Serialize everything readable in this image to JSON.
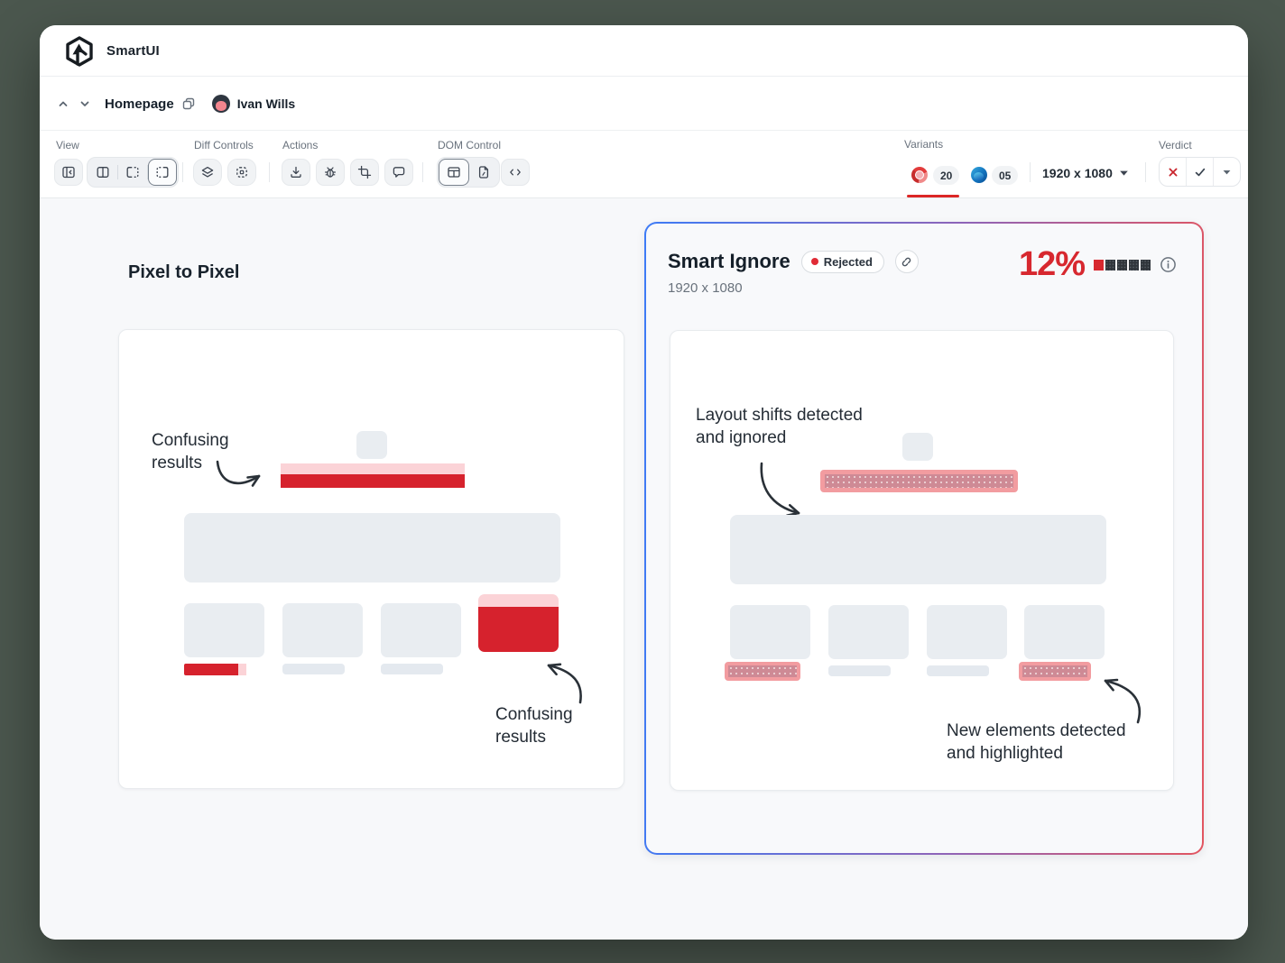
{
  "app": {
    "name": "SmartUI"
  },
  "nav": {
    "title": "Homepage",
    "user_name": "Ivan Wills"
  },
  "toolbar": {
    "view_label": "View",
    "diff_label": "Diff Controls",
    "actions_label": "Actions",
    "dom_label": "DOM Control",
    "variants_label": "Variants",
    "verdict_label": "Verdict",
    "chrome_count": "20",
    "edge_count": "05",
    "resolution": "1920 x 1080"
  },
  "left_panel": {
    "title": "Pixel to Pixel",
    "anno_top_line1": "Confusing",
    "anno_top_line2": "results",
    "anno_bottom_line1": "Confusing",
    "anno_bottom_line2": "results"
  },
  "right_panel": {
    "title": "Smart Ignore",
    "badge": "Rejected",
    "resolution": "1920 x 1080",
    "mismatch_pct": "12%",
    "severity": {
      "filled": 1,
      "total": 5
    },
    "anno_top_line1": "Layout shifts detected",
    "anno_top_line2": "and ignored",
    "anno_bottom_line1": "New elements detected",
    "anno_bottom_line2": "and highlighted"
  },
  "icons": [
    "smartui-logo-icon",
    "chevron-up-icon",
    "chevron-down-icon",
    "copy-icon",
    "avatar",
    "panel-collapse-icon",
    "split-view-icon",
    "split-right-dashed-icon",
    "split-left-dashed-icon",
    "layers-icon",
    "focus-region-icon",
    "download-icon",
    "bug-icon",
    "crop-icon",
    "comment-icon",
    "table-icon",
    "file-code-icon",
    "code-icon",
    "chrome-icon",
    "edge-icon",
    "reject-x-icon",
    "approve-check-icon",
    "dropdown-chevron-icon",
    "link-icon",
    "info-icon"
  ],
  "colors": {
    "page_bg": "#4B574E",
    "accent_red": "#D6222D",
    "pink_light": "#FBD3D7",
    "highlight_border": "#F29CA0",
    "highlight_fill": "#CE8A95",
    "gradient_blue": "#3D7BF6",
    "gradient_red": "#E25560",
    "variant_selected_underline": "#DC2626"
  }
}
